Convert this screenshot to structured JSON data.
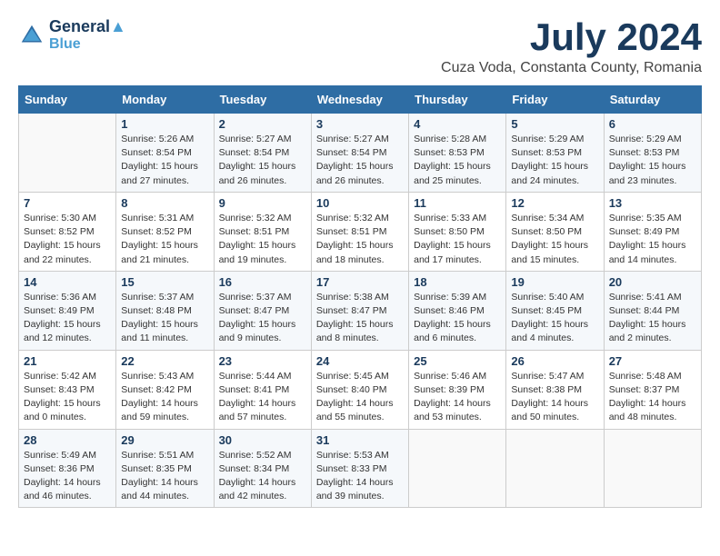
{
  "header": {
    "logo_line1": "General",
    "logo_line2": "Blue",
    "month": "July 2024",
    "location": "Cuza Voda, Constanta County, Romania"
  },
  "days_of_week": [
    "Sunday",
    "Monday",
    "Tuesday",
    "Wednesday",
    "Thursday",
    "Friday",
    "Saturday"
  ],
  "weeks": [
    [
      {
        "day": "",
        "info": ""
      },
      {
        "day": "1",
        "info": "Sunrise: 5:26 AM\nSunset: 8:54 PM\nDaylight: 15 hours\nand 27 minutes."
      },
      {
        "day": "2",
        "info": "Sunrise: 5:27 AM\nSunset: 8:54 PM\nDaylight: 15 hours\nand 26 minutes."
      },
      {
        "day": "3",
        "info": "Sunrise: 5:27 AM\nSunset: 8:54 PM\nDaylight: 15 hours\nand 26 minutes."
      },
      {
        "day": "4",
        "info": "Sunrise: 5:28 AM\nSunset: 8:53 PM\nDaylight: 15 hours\nand 25 minutes."
      },
      {
        "day": "5",
        "info": "Sunrise: 5:29 AM\nSunset: 8:53 PM\nDaylight: 15 hours\nand 24 minutes."
      },
      {
        "day": "6",
        "info": "Sunrise: 5:29 AM\nSunset: 8:53 PM\nDaylight: 15 hours\nand 23 minutes."
      }
    ],
    [
      {
        "day": "7",
        "info": "Sunrise: 5:30 AM\nSunset: 8:52 PM\nDaylight: 15 hours\nand 22 minutes."
      },
      {
        "day": "8",
        "info": "Sunrise: 5:31 AM\nSunset: 8:52 PM\nDaylight: 15 hours\nand 21 minutes."
      },
      {
        "day": "9",
        "info": "Sunrise: 5:32 AM\nSunset: 8:51 PM\nDaylight: 15 hours\nand 19 minutes."
      },
      {
        "day": "10",
        "info": "Sunrise: 5:32 AM\nSunset: 8:51 PM\nDaylight: 15 hours\nand 18 minutes."
      },
      {
        "day": "11",
        "info": "Sunrise: 5:33 AM\nSunset: 8:50 PM\nDaylight: 15 hours\nand 17 minutes."
      },
      {
        "day": "12",
        "info": "Sunrise: 5:34 AM\nSunset: 8:50 PM\nDaylight: 15 hours\nand 15 minutes."
      },
      {
        "day": "13",
        "info": "Sunrise: 5:35 AM\nSunset: 8:49 PM\nDaylight: 15 hours\nand 14 minutes."
      }
    ],
    [
      {
        "day": "14",
        "info": "Sunrise: 5:36 AM\nSunset: 8:49 PM\nDaylight: 15 hours\nand 12 minutes."
      },
      {
        "day": "15",
        "info": "Sunrise: 5:37 AM\nSunset: 8:48 PM\nDaylight: 15 hours\nand 11 minutes."
      },
      {
        "day": "16",
        "info": "Sunrise: 5:37 AM\nSunset: 8:47 PM\nDaylight: 15 hours\nand 9 minutes."
      },
      {
        "day": "17",
        "info": "Sunrise: 5:38 AM\nSunset: 8:47 PM\nDaylight: 15 hours\nand 8 minutes."
      },
      {
        "day": "18",
        "info": "Sunrise: 5:39 AM\nSunset: 8:46 PM\nDaylight: 15 hours\nand 6 minutes."
      },
      {
        "day": "19",
        "info": "Sunrise: 5:40 AM\nSunset: 8:45 PM\nDaylight: 15 hours\nand 4 minutes."
      },
      {
        "day": "20",
        "info": "Sunrise: 5:41 AM\nSunset: 8:44 PM\nDaylight: 15 hours\nand 2 minutes."
      }
    ],
    [
      {
        "day": "21",
        "info": "Sunrise: 5:42 AM\nSunset: 8:43 PM\nDaylight: 15 hours\nand 0 minutes."
      },
      {
        "day": "22",
        "info": "Sunrise: 5:43 AM\nSunset: 8:42 PM\nDaylight: 14 hours\nand 59 minutes."
      },
      {
        "day": "23",
        "info": "Sunrise: 5:44 AM\nSunset: 8:41 PM\nDaylight: 14 hours\nand 57 minutes."
      },
      {
        "day": "24",
        "info": "Sunrise: 5:45 AM\nSunset: 8:40 PM\nDaylight: 14 hours\nand 55 minutes."
      },
      {
        "day": "25",
        "info": "Sunrise: 5:46 AM\nSunset: 8:39 PM\nDaylight: 14 hours\nand 53 minutes."
      },
      {
        "day": "26",
        "info": "Sunrise: 5:47 AM\nSunset: 8:38 PM\nDaylight: 14 hours\nand 50 minutes."
      },
      {
        "day": "27",
        "info": "Sunrise: 5:48 AM\nSunset: 8:37 PM\nDaylight: 14 hours\nand 48 minutes."
      }
    ],
    [
      {
        "day": "28",
        "info": "Sunrise: 5:49 AM\nSunset: 8:36 PM\nDaylight: 14 hours\nand 46 minutes."
      },
      {
        "day": "29",
        "info": "Sunrise: 5:51 AM\nSunset: 8:35 PM\nDaylight: 14 hours\nand 44 minutes."
      },
      {
        "day": "30",
        "info": "Sunrise: 5:52 AM\nSunset: 8:34 PM\nDaylight: 14 hours\nand 42 minutes."
      },
      {
        "day": "31",
        "info": "Sunrise: 5:53 AM\nSunset: 8:33 PM\nDaylight: 14 hours\nand 39 minutes."
      },
      {
        "day": "",
        "info": ""
      },
      {
        "day": "",
        "info": ""
      },
      {
        "day": "",
        "info": ""
      }
    ]
  ]
}
